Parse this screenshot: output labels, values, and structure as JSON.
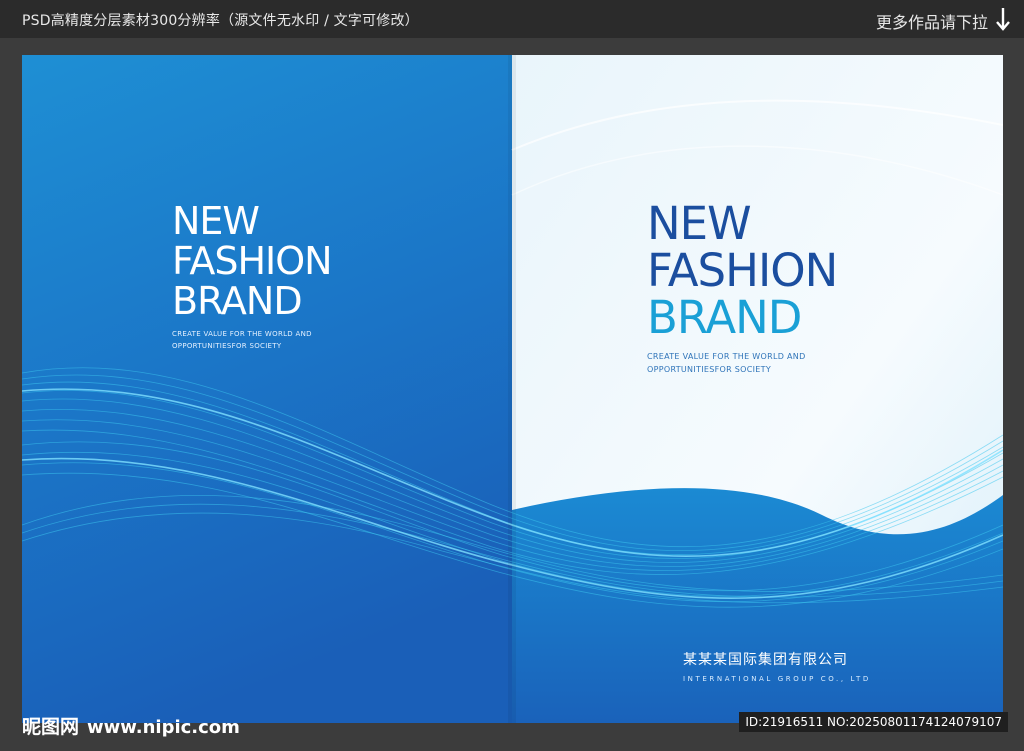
{
  "header": {
    "title": "PSD高精度分层素材300分辨率（源文件无水印 / 文字可修改）",
    "more_link": "更多作品请下拉"
  },
  "left_cover": {
    "title_lines": [
      "NEW",
      "FASHION",
      "BRAND"
    ],
    "subtitle_lines": [
      "CREATE VALUE FOR THE WORLD AND",
      "OPPORTUNITIESFOR SOCIETY"
    ]
  },
  "right_cover": {
    "title_lines": [
      "NEW",
      "FASHION",
      "BRAND"
    ],
    "subtitle_lines": [
      "CREATE VALUE FOR THE WORLD AND",
      "OPPORTUNITIESFOR SOCIETY"
    ],
    "company_cn": "某某某国际集团有限公司",
    "company_en": "INTERNATIONAL GROUP CO., LTD"
  },
  "footer": {
    "watermark_logo": "昵图网",
    "watermark_url": "www.nipic.com",
    "id_text": "ID:21916511 NO:20250801174124079107"
  },
  "colors": {
    "left_bg_top": "#1e8fd4",
    "left_bg_bottom": "#1a5fb8",
    "right_title_dark": "#1b4e9f",
    "right_title_light": "#1aa0d6",
    "wave": "#3cc6ef"
  },
  "icons": {
    "more": "down-arrow-icon"
  }
}
